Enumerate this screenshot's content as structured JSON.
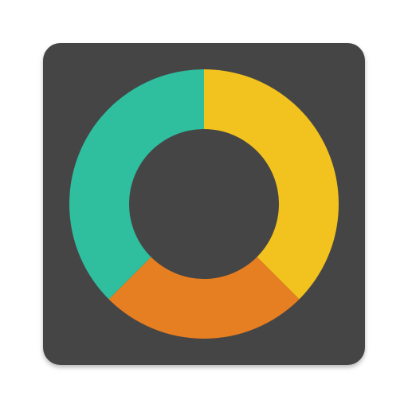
{
  "icon": {
    "name": "donut-chart-app-icon",
    "background_color": "#454545",
    "shadow_color": "#000000"
  },
  "segments": [
    {
      "name": "yellow-segment",
      "color": "#F2C31E",
      "share": 0.375
    },
    {
      "name": "orange-segment",
      "color": "#E67E22",
      "share": 0.25
    },
    {
      "name": "teal-segment",
      "color": "#2FBE9E",
      "share": 0.375
    }
  ]
}
